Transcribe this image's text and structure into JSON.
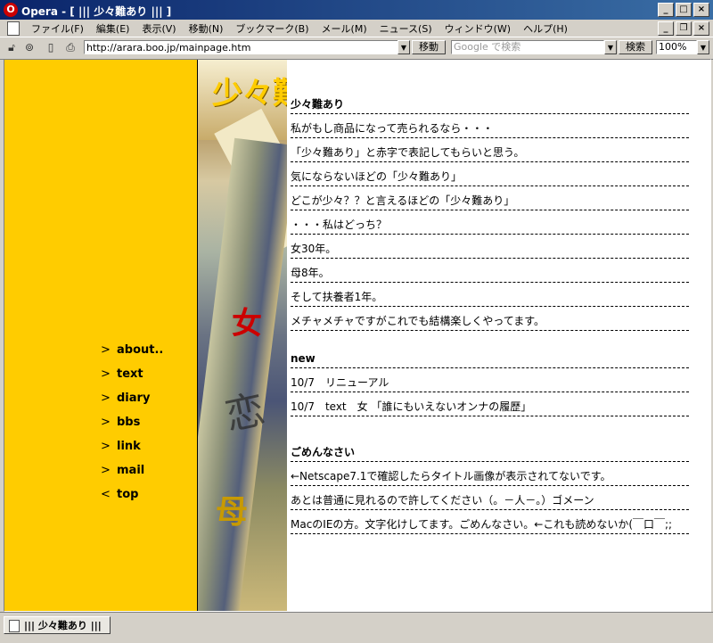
{
  "window": {
    "title": "Opera - [ ||| 少々難あり ||| ]",
    "app_icon": "opera-o-icon"
  },
  "menu": [
    "ファイル(F)",
    "編集(E)",
    "表示(V)",
    "移動(N)",
    "ブックマーク(B)",
    "メール(M)",
    "ニュース(S)",
    "ウィンドウ(W)",
    "ヘルプ(H)"
  ],
  "address": {
    "url": "http://arara.boo.jp/mainpage.htm",
    "go_label": "移動",
    "search_placeholder": "Google で検索",
    "search_label": "検索",
    "zoom": "100%"
  },
  "page": {
    "logo_text": "少々難",
    "art_glyphs": {
      "onna": "女",
      "ren": "恋",
      "haha": "母"
    },
    "nav": [
      {
        "chev": ">",
        "label": "about.."
      },
      {
        "chev": ">",
        "label": "text"
      },
      {
        "chev": ">",
        "label": "diary"
      },
      {
        "chev": ">",
        "label": "bbs"
      },
      {
        "chev": ">",
        "label": "link"
      },
      {
        "chev": ">",
        "label": "mail"
      },
      {
        "chev": "<",
        "label": "top"
      }
    ],
    "intro": {
      "heading": "少々難あり",
      "lines": [
        "私がもし商品になって売られるなら・・・",
        "「少々難あり」と赤字で表記してもらいと思う。",
        "気にならないほどの「少々難あり」",
        "どこが少々？？と言えるほどの「少々難あり」",
        "・・・私はどっち？",
        "女30年。",
        "母8年。",
        "そして扶養者1年。",
        "メチャメチャですがこれでも結構楽しくやってます。"
      ]
    },
    "news": {
      "heading": "new",
      "lines": [
        "10/7　リニューアル",
        "10/7　text　女 「誰にもいえないオンナの履歴」"
      ]
    },
    "sorry": {
      "heading": "ごめんなさい",
      "lines": [
        "←Netscape7.1で確認したらタイトル画像が表示されてないです。",
        "あとは普通に見れるので許してください（。－人－。）ゴメーン",
        "MacのIEの方。文字化けしてます。ごめんなさい。←これも読めないか(￣口￣;;"
      ]
    }
  },
  "status": {
    "tab_label": "||| 少々難あり |||"
  },
  "colors": {
    "left_frame": "#ffcc00",
    "titlebar_start": "#0a246a",
    "titlebar_end": "#3a6ea5",
    "chrome": "#d4d0c8"
  }
}
